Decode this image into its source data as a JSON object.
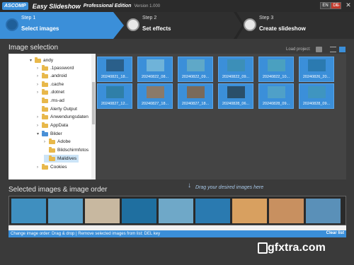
{
  "titlebar": {
    "logo": "ASCOMP",
    "app_title": "Easy Slideshow",
    "edition": "Professional Edition",
    "version": "Version 1.000",
    "lang_en": "EN",
    "lang_de": "DE",
    "minimize": "–",
    "close": "✕"
  },
  "steps": [
    {
      "num": "Step 1",
      "label": "Select images"
    },
    {
      "num": "Step 2",
      "label": "Set effects"
    },
    {
      "num": "Step 3",
      "label": "Create slideshow"
    }
  ],
  "image_selection": {
    "title": "Image selection",
    "load_project": "Load project:"
  },
  "tree": [
    {
      "label": "andy",
      "arrow": "▾",
      "folder": "yellow"
    },
    {
      "label": ".1password",
      "arrow": "›",
      "folder": "yellow"
    },
    {
      "label": ".android",
      "arrow": "›",
      "folder": "yellow"
    },
    {
      "label": ".cache",
      "arrow": "›",
      "folder": "yellow"
    },
    {
      "label": ".dotnet",
      "arrow": "›",
      "folder": "yellow"
    },
    {
      "label": ".ms-ad",
      "arrow": "",
      "folder": "yellow"
    },
    {
      "label": "Alerty Output",
      "arrow": "",
      "folder": "yellow"
    },
    {
      "label": "Anwendungsdaten",
      "arrow": "›",
      "folder": "yellow"
    },
    {
      "label": "AppData",
      "arrow": "›",
      "folder": "yellow"
    },
    {
      "label": "Bilder",
      "arrow": "▾",
      "folder": "blue"
    },
    {
      "label": "Adobe",
      "arrow": "›",
      "folder": "yellow"
    },
    {
      "label": "Bildschirmfotos",
      "arrow": "",
      "folder": "yellow"
    },
    {
      "label": "Malidives",
      "arrow": "",
      "folder": "yellow"
    },
    {
      "label": "Cookies",
      "arrow": "›",
      "folder": "yellow"
    }
  ],
  "thumbs": [
    {
      "caption": "20240821_18...",
      "color": "#2a5f8a"
    },
    {
      "caption": "20240822_08...",
      "color": "#6fb3d9"
    },
    {
      "caption": "20240822_09...",
      "color": "#5fa8c8"
    },
    {
      "caption": "20240822_09...",
      "color": "#3c8fb8"
    },
    {
      "caption": "20240822_10...",
      "color": "#4aa0c0"
    },
    {
      "caption": "20240826_20...",
      "color": "#2b7ab0"
    },
    {
      "caption": "20240827_12...",
      "color": "#2f7fa8"
    },
    {
      "caption": "20240827_18...",
      "color": "#8a7a6a"
    },
    {
      "caption": "20240827_18...",
      "color": "#7a6a5a"
    },
    {
      "caption": "20240828_06...",
      "color": "#2a4f6a"
    },
    {
      "caption": "20240828_09...",
      "color": "#4fa0c8"
    },
    {
      "caption": "20240828_09...",
      "color": "#3f95c0"
    }
  ],
  "order": {
    "title": "Selected images & image order",
    "drag_hint": "Drag your desired images here",
    "frames": [
      "#3f8fbf",
      "#5a9fc8",
      "#c8b8a0",
      "#1f6fa0",
      "#6fa8c8",
      "#2a7ab0",
      "#d8a060",
      "#c89060",
      "#5a90b8",
      "#3a80a8",
      "#8ab8d0",
      "#4aa0d0"
    ],
    "instructions": "Change image order: Drag & drop | Remove selected images from list: DEL key",
    "clear_list": "Clear list"
  },
  "watermark": "gfxtra.com"
}
